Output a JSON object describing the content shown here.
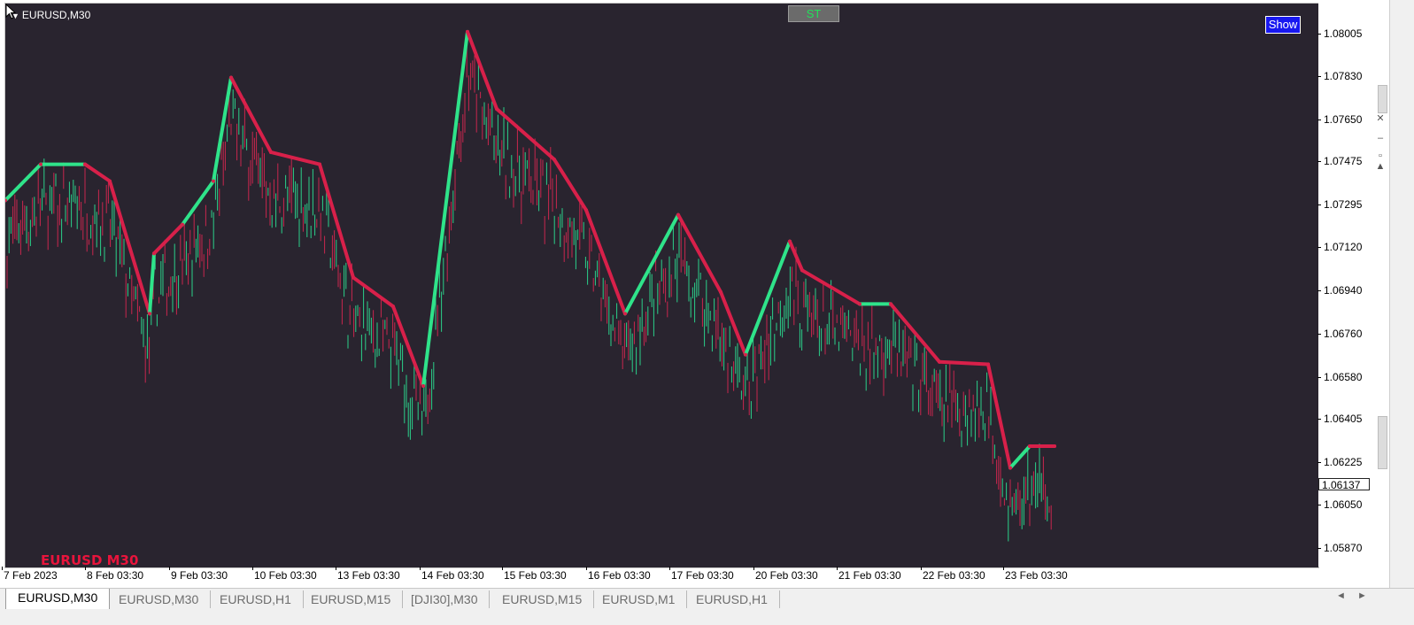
{
  "window": {
    "symbol_title": "EURUSD,M30",
    "st_button": "ST",
    "show_button": "Show",
    "pair_label": "EURUSD M30",
    "current_price": "1.06137"
  },
  "colors": {
    "background": "#29242f",
    "bull_candle": "#2bd08a",
    "bear_candle": "#c8264e",
    "supertrend_up": "#2fe38a",
    "supertrend_down": "#d8204a",
    "st_text": "#22e05a",
    "show_button_bg": "#1818f0",
    "pair_label": "#e8143c"
  },
  "price_axis": {
    "labels": [
      "1.08005",
      "1.07830",
      "1.07650",
      "1.07475",
      "1.07295",
      "1.07120",
      "1.06940",
      "1.06760",
      "1.06580",
      "1.06405",
      "1.06225",
      "1.06050",
      "1.05870"
    ],
    "values": [
      1.08005,
      1.0783,
      1.0765,
      1.07475,
      1.07295,
      1.0712,
      1.0694,
      1.0676,
      1.0658,
      1.06405,
      1.06225,
      1.0605,
      1.0587
    ]
  },
  "time_axis": {
    "labels": [
      "7 Feb 2023",
      "8 Feb 03:30",
      "9 Feb 03:30",
      "10 Feb 03:30",
      "13 Feb 03:30",
      "14 Feb 03:30",
      "15 Feb 03:30",
      "16 Feb 03:30",
      "17 Feb 03:30",
      "20 Feb 03:30",
      "21 Feb 03:30",
      "22 Feb 03:30",
      "23 Feb 03:30"
    ]
  },
  "chart_data": {
    "type": "line",
    "ylim": [
      1.0584,
      1.0818
    ],
    "x": [
      0,
      40,
      90,
      118,
      163,
      168,
      200,
      235,
      255,
      300,
      355,
      393,
      438,
      472,
      522,
      555,
      620,
      656,
      700,
      760,
      808,
      836,
      886,
      900,
      965,
      1000,
      1055,
      1110,
      1135,
      1157,
      1185
    ],
    "series": [
      {
        "name": "",
        "values": [
          1.0732,
          1.0747,
          1.0747,
          1.074,
          1.0685,
          1.071,
          1.0722,
          1.074,
          1.0783,
          1.0752,
          1.0747,
          1.07,
          1.0688,
          1.0655,
          1.0802,
          1.077,
          1.0749,
          1.0728,
          1.0685,
          1.0726,
          1.0694,
          1.0668,
          1.0715,
          1.0703,
          1.0689,
          1.0689,
          1.0665,
          1.0664,
          1.0621,
          1.063,
          1.063
        ]
      }
    ]
  },
  "tabs": [
    "EURUSD,M30",
    "EURUSD,M30",
    "EURUSD,H1",
    "EURUSD,M15",
    "[DJI30],M30",
    "EURUSD,M15",
    "EURUSD,M1",
    "EURUSD,H1"
  ]
}
